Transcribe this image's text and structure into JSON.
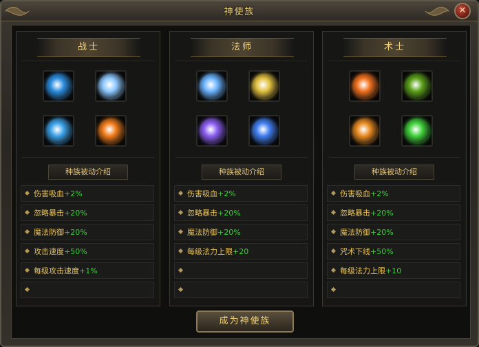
{
  "window": {
    "title": "神使族",
    "close_label": "✕"
  },
  "classes": [
    {
      "name": "战士",
      "skills": [
        {
          "icon": "blue-slash-icon",
          "color": "#2b8de0"
        },
        {
          "icon": "blue-burst-icon",
          "color": "#8cc8ff"
        },
        {
          "icon": "claw-strike-icon",
          "color": "#3aa1e8"
        },
        {
          "icon": "fire-orb-icon",
          "color": "#f07a18"
        }
      ],
      "passive_title": "种族被动介绍",
      "passives": [
        {
          "label": "伤害吸血",
          "value": "+2%"
        },
        {
          "label": "忽略暴击",
          "value": "+20%"
        },
        {
          "label": "魔法防御",
          "value": "+20%"
        },
        {
          "label": "攻击速度",
          "value": "+50%"
        },
        {
          "label": "每级攻击速度",
          "value": "+1%"
        },
        {
          "label": "",
          "value": ""
        }
      ]
    },
    {
      "name": "法师",
      "skills": [
        {
          "icon": "lightning-pillar-icon",
          "color": "#6ab4ff"
        },
        {
          "icon": "shield-figure-icon",
          "color": "#e0c040"
        },
        {
          "icon": "purple-lightning-icon",
          "color": "#8a5cf0"
        },
        {
          "icon": "blue-lightning-orb-icon",
          "color": "#3f7ef0"
        }
      ],
      "passive_title": "种族被动介绍",
      "passives": [
        {
          "label": "伤害吸血",
          "value": "+2%"
        },
        {
          "label": "忽略暴击",
          "value": "+20%"
        },
        {
          "label": "魔法防御",
          "value": "+20%"
        },
        {
          "label": "每级法力上限",
          "value": "+20"
        },
        {
          "label": "",
          "value": ""
        },
        {
          "label": "",
          "value": ""
        }
      ]
    },
    {
      "name": "术士",
      "skills": [
        {
          "icon": "fire-swirl-icon",
          "color": "#f0701c"
        },
        {
          "icon": "green-thorn-icon",
          "color": "#5aa018"
        },
        {
          "icon": "fire-shield-icon",
          "color": "#e88a20"
        },
        {
          "icon": "green-poison-icon",
          "color": "#3fd03a"
        }
      ],
      "passive_title": "种族被动介绍",
      "passives": [
        {
          "label": "伤害吸血",
          "value": "+2%"
        },
        {
          "label": "忽略暴击",
          "value": "+20%"
        },
        {
          "label": "魔法防御",
          "value": "+20%"
        },
        {
          "label": "咒术下线",
          "value": "+50%"
        },
        {
          "label": "每级法力上限",
          "value": "+10"
        },
        {
          "label": "",
          "value": ""
        }
      ]
    }
  ],
  "action": {
    "label": "成为神使族"
  },
  "colors": {
    "gold_text": "#e8c25a",
    "value_green": "#3bd13b",
    "title_gold": "#f1d27a"
  }
}
